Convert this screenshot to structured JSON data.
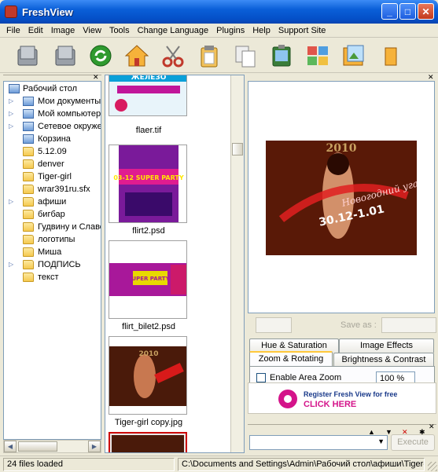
{
  "window": {
    "title": "FreshView"
  },
  "menu": [
    "File",
    "Edit",
    "Image",
    "View",
    "Tools",
    "Change Language",
    "Plugins",
    "Help",
    "Support Site"
  ],
  "toolbar_icons": [
    "folder-back-icon",
    "folder-forward-icon",
    "refresh-icon",
    "home-icon",
    "cut-icon",
    "paste-icon",
    "copy-icon",
    "slideshow-icon",
    "thumbnails-icon",
    "image-viewer-icon",
    "more-icon"
  ],
  "tree": {
    "root": "Рабочий стол",
    "items": [
      {
        "label": "Мои документы",
        "icon": "my-documents-icon",
        "expandable": true
      },
      {
        "label": "Мой компьютер",
        "icon": "my-computer-icon",
        "expandable": true
      },
      {
        "label": "Сетевое окружение",
        "icon": "network-icon",
        "expandable": true
      },
      {
        "label": "Корзина",
        "icon": "recycle-bin-icon",
        "expandable": false
      },
      {
        "label": "5.12.09",
        "icon": "folder-icon",
        "expandable": false
      },
      {
        "label": "denver",
        "icon": "folder-icon",
        "expandable": false
      },
      {
        "label": "Tiger-girl",
        "icon": "folder-icon",
        "expandable": false
      },
      {
        "label": "wrar391ru.sfx",
        "icon": "folder-icon",
        "expandable": false
      },
      {
        "label": "афиши",
        "icon": "folder-icon",
        "expandable": true
      },
      {
        "label": "бигбар",
        "icon": "folder-icon",
        "expandable": false
      },
      {
        "label": "Гудвину и Славе",
        "icon": "folder-icon",
        "expandable": false
      },
      {
        "label": "логотипы",
        "icon": "folder-icon",
        "expandable": false
      },
      {
        "label": "Миша",
        "icon": "folder-icon",
        "expandable": false
      },
      {
        "label": "ПОДПИСЬ",
        "icon": "folder-icon",
        "expandable": true
      },
      {
        "label": "текст",
        "icon": "folder-icon",
        "expandable": false
      }
    ]
  },
  "thumbnails": [
    {
      "name": "flaer.tif",
      "poster_text": "ЖЕЛЕЗО"
    },
    {
      "name": "flirt2.psd",
      "poster_text": "03-12 SUPER PARTY"
    },
    {
      "name": "flirt_bilet2.psd",
      "poster_text": "SUPER PARTY"
    },
    {
      "name": "Tiger-girl copy.jpg",
      "poster_text": "2010"
    }
  ],
  "preview": {
    "year_text": "2010",
    "headline": "Новогодний угар",
    "dates": "30.12-1.01"
  },
  "controls": {
    "save_as_label": "Save as :",
    "execute_label": "Execute"
  },
  "tabs_row1": [
    "Hue & Saturation",
    "Image Effects"
  ],
  "tabs_row2": [
    "Zoom & Rotating",
    "Brightness & Contrast"
  ],
  "zoom_panel": {
    "checkbox_label": "Enable Area Zoom",
    "zoom_value": "100 %"
  },
  "banner": {
    "line1": "Register Fresh View for free",
    "line2": "CLICK HERE"
  },
  "status": {
    "count_text": "24 files loaded",
    "path_text": "C:\\Documents and Settings\\Admin\\Рабочий стол\\афиши\\Tiger-girl copy.jpg"
  },
  "colors": {
    "title_blue": "#0a5fd8",
    "accent_orange": "#ffc83c",
    "banner_pink": "#d4148a"
  }
}
